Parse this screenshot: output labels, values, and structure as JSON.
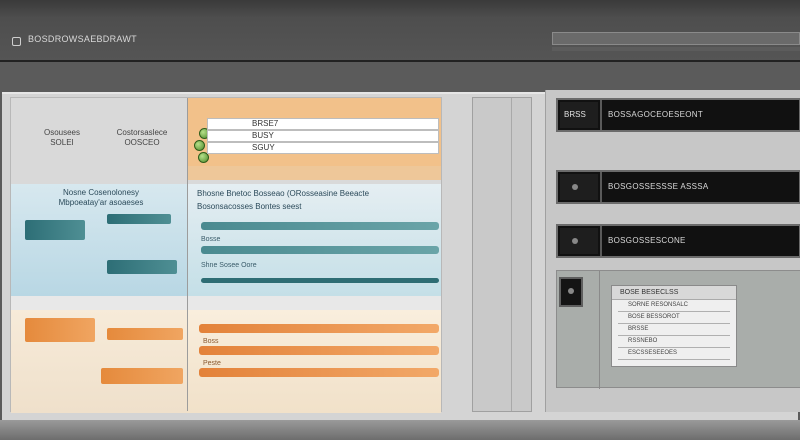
{
  "window": {
    "title": "BOSDROWSAEBDRAWT"
  },
  "left_panel": {
    "headers": {
      "col1": "Osousees\nSOLEI",
      "col2": "Costorsaslece\nOOSCEO"
    },
    "fields": [
      "BRSE7",
      "BUSY",
      "SGUY"
    ],
    "mid_section": {
      "left_title": "Nosne Cosenolonesy\nMbpoeatay'ar asoaeses",
      "right_title": "Bhosne Bnetoc Bosseao (ORosseasine Beeacte",
      "right_subtitle": "Bosonsacosses Bontes seest",
      "labels": [
        "Bosse",
        "Shne Sosee Oore"
      ]
    },
    "bottom_section": {
      "labels": [
        "Boss",
        "Peste"
      ]
    }
  },
  "right_panel": {
    "rows": [
      {
        "tag": "BRSS",
        "label": "BOSSAGOCEOESEONT"
      },
      {
        "label": "BOSGOSSESSSE ASSSA"
      },
      {
        "label": "BOSGOSSESCONE"
      }
    ],
    "dialog": {
      "title": "BOSE BESECLSS",
      "lines": [
        "SORNE RESONSALC",
        "BOSE BESSOROT",
        "BRSSE",
        "RSSNEBO",
        "ESCSSESEEOES"
      ]
    }
  },
  "colors": {
    "accent_orange": "#f0a561",
    "accent_teal": "#2d6e76",
    "header_orange": "#f2c18a",
    "status_green": "#4c8a2a"
  }
}
